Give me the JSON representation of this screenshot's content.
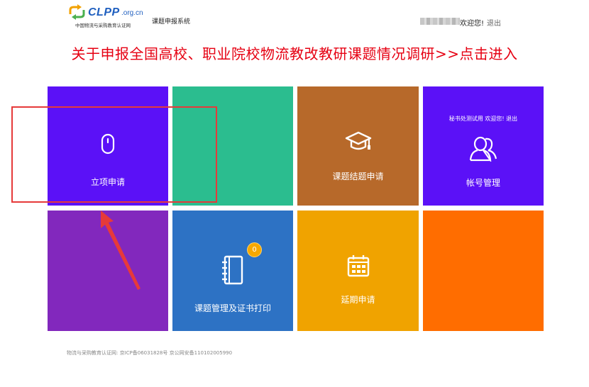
{
  "header": {
    "logo": {
      "name": "CLPP",
      "domain": ".org.cn",
      "subtitle": "中国物流与采购教育认证网",
      "icon": "recycle-arrows-icon"
    },
    "system_name": "课题申报系统",
    "user": {
      "welcome": "欢迎您!",
      "logout": "退出"
    }
  },
  "announcement": "关于申报全国高校、职业院校物流教改教研课题情况调研>>点击进入",
  "colors": {
    "announcement": "#e60012",
    "tiles": [
      "#5b11f7",
      "#2bbd8f",
      "#b7692a",
      "#5b11f7",
      "#8228bd",
      "#2d72c4",
      "#f0a300",
      "#ff6d00"
    ],
    "annotation": "#e63a3a"
  },
  "tiles": [
    {
      "label": "立项申请",
      "icon": "mouse-icon"
    },
    {
      "label": "",
      "icon": ""
    },
    {
      "label": "课题结题申请",
      "icon": "graduation-cap-icon"
    },
    {
      "label": "帐号管理",
      "icon": "users-icon",
      "top_text": "秘书处测试用 欢迎您!",
      "top_logout": "退出"
    },
    {
      "label": "",
      "icon": ""
    },
    {
      "label": "课题管理及证书打印",
      "icon": "notebook-icon",
      "badge": "0"
    },
    {
      "label": "延期申请",
      "icon": "calendar-icon"
    },
    {
      "label": "",
      "icon": ""
    }
  ],
  "footer": "物流与采购教育认证网: 京ICP备06031828号 京公网安备110102005990"
}
